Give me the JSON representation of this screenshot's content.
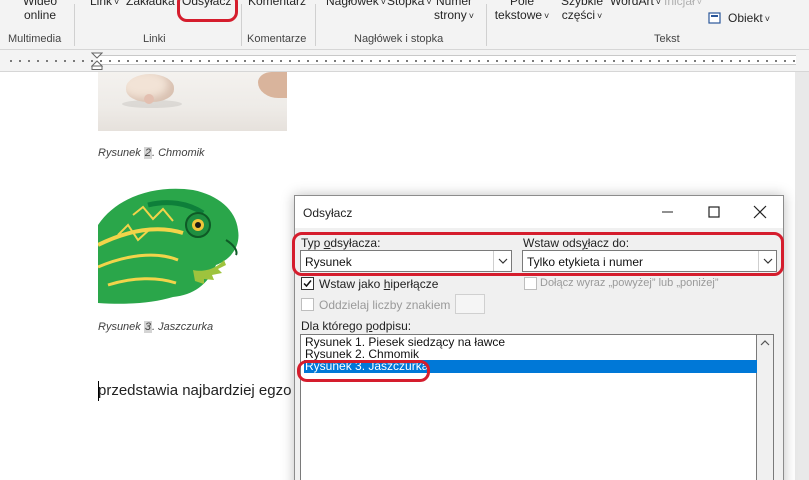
{
  "ribbon": {
    "buttons": {
      "video": "Wideo\nonline",
      "link": "Link",
      "bookmark": "Zakładka",
      "crossref": "Odsyłacz",
      "comment": "Komentarz",
      "header": "Nagłówek",
      "footer": "Stopka",
      "page_number": "Numer\nstrony",
      "textbox": "Pole\ntekstowe",
      "quickparts": "Szybkie\nczęści",
      "wordart": "WordArt",
      "initial": "Inicjał",
      "object": "Obiekt"
    },
    "groups": {
      "multimedia": "Multimedia",
      "links": "Linki",
      "comments": "Komentarze",
      "header_footer": "Nagłówek i stopka",
      "text": "Tekst"
    }
  },
  "document": {
    "caption1_prefix": "Rysunek ",
    "caption1_num": "2",
    "caption1_suffix": ". Chmomik",
    "caption2_prefix": "Rysunek ",
    "caption2_num": "3",
    "caption2_suffix": ". Jaszczurka",
    "body_text": "przedstawia najbardziej egzo"
  },
  "dialog": {
    "title": "Odsyłacz",
    "type_label_pre": "Typ ",
    "type_label_u": "o",
    "type_label_post": "dsyłacza:",
    "type_value": "Rysunek",
    "insert_label_pre": "Wstaw ods",
    "insert_label_u": "y",
    "insert_label_post": "łacz do:",
    "insert_value": "Tylko etykieta i numer",
    "hyperlink_pre": "Wstaw jako ",
    "hyperlink_u": "h",
    "hyperlink_post": "iperłącze",
    "above_below": "Dołącz wyraz „powyżej” lub „poniżej”",
    "separate_numbers": "Oddzielaj liczby znakiem",
    "which_caption_pre": "Dla którego ",
    "which_caption_u": "p",
    "which_caption_post": "odpisu:",
    "items": [
      "Rysunek 1. Piesek siedzący na ławce",
      "Rysunek 2. Chmomik",
      "Rysunek 3. Jaszczurka"
    ]
  },
  "colors": {
    "highlight_ring": "#d51d2d",
    "selection": "#0078d7"
  }
}
